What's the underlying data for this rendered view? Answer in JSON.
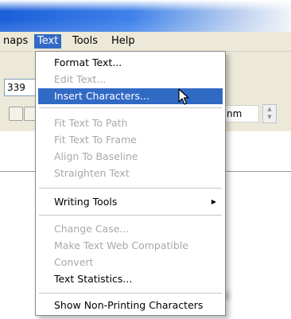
{
  "menubar": {
    "items": [
      {
        "label": "naps"
      },
      {
        "label": "Text"
      },
      {
        "label": "Tools"
      },
      {
        "label": "Help"
      }
    ]
  },
  "toolbar": {
    "field_value": "339",
    "unit_value": "nm"
  },
  "text_menu": {
    "items": [
      {
        "label": "Format Text..."
      },
      {
        "label": "Edit Text..."
      },
      {
        "label": "Insert Characters..."
      },
      {
        "label": "Fit Text To Path"
      },
      {
        "label": "Fit Text To Frame"
      },
      {
        "label": "Align To Baseline"
      },
      {
        "label": "Straighten Text"
      },
      {
        "label": "Writing Tools"
      },
      {
        "label": "Change Case..."
      },
      {
        "label": "Make Text Web Compatible"
      },
      {
        "label": "Convert"
      },
      {
        "label": "Text Statistics..."
      },
      {
        "label": "Show Non-Printing Characters"
      }
    ]
  },
  "colors": {
    "highlight": "#316ac5",
    "disabled_text": "#a8a8a8",
    "menubar_bg": "#ece9d8"
  }
}
